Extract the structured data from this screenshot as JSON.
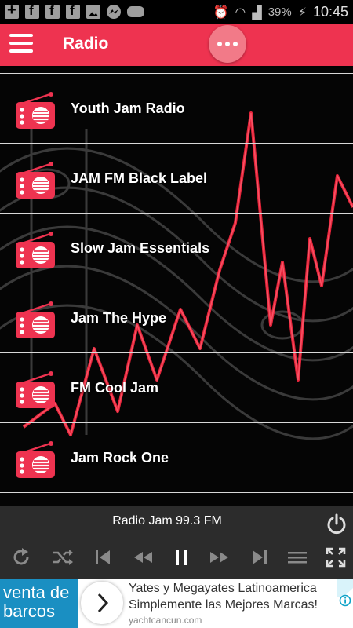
{
  "status_bar": {
    "battery": "39%",
    "time": "10:45"
  },
  "app_bar": {
    "title": "Radio",
    "menu_icon": "hamburger-icon",
    "more_icon": "more-dots-icon",
    "color": "#ee3350"
  },
  "stations": [
    {
      "name": "Youth Jam Radio"
    },
    {
      "name": "JAM FM Black Label"
    },
    {
      "name": "Slow Jam Essentials"
    },
    {
      "name": "Jam The Hype"
    },
    {
      "name": "FM Cool Jam"
    },
    {
      "name": "Jam Rock One"
    }
  ],
  "player": {
    "now_playing": "Radio Jam 99.3 FM",
    "controls": [
      "refresh-icon",
      "shuffle-icon",
      "skip-previous-icon",
      "rewind-icon",
      "pause-icon",
      "fast-forward-icon",
      "skip-next-icon",
      "queue-list-icon",
      "fullscreen-icon"
    ],
    "power_icon": "power-icon"
  },
  "ad": {
    "left_text_line1": "venta de",
    "left_text_line2": "barcos",
    "headline1": "Yates y Megayates Latinoamerica",
    "headline2": "Simplemente las Mejores Marcas!",
    "url": "yachtcancun.com",
    "left_color": "#1a8fc2"
  }
}
